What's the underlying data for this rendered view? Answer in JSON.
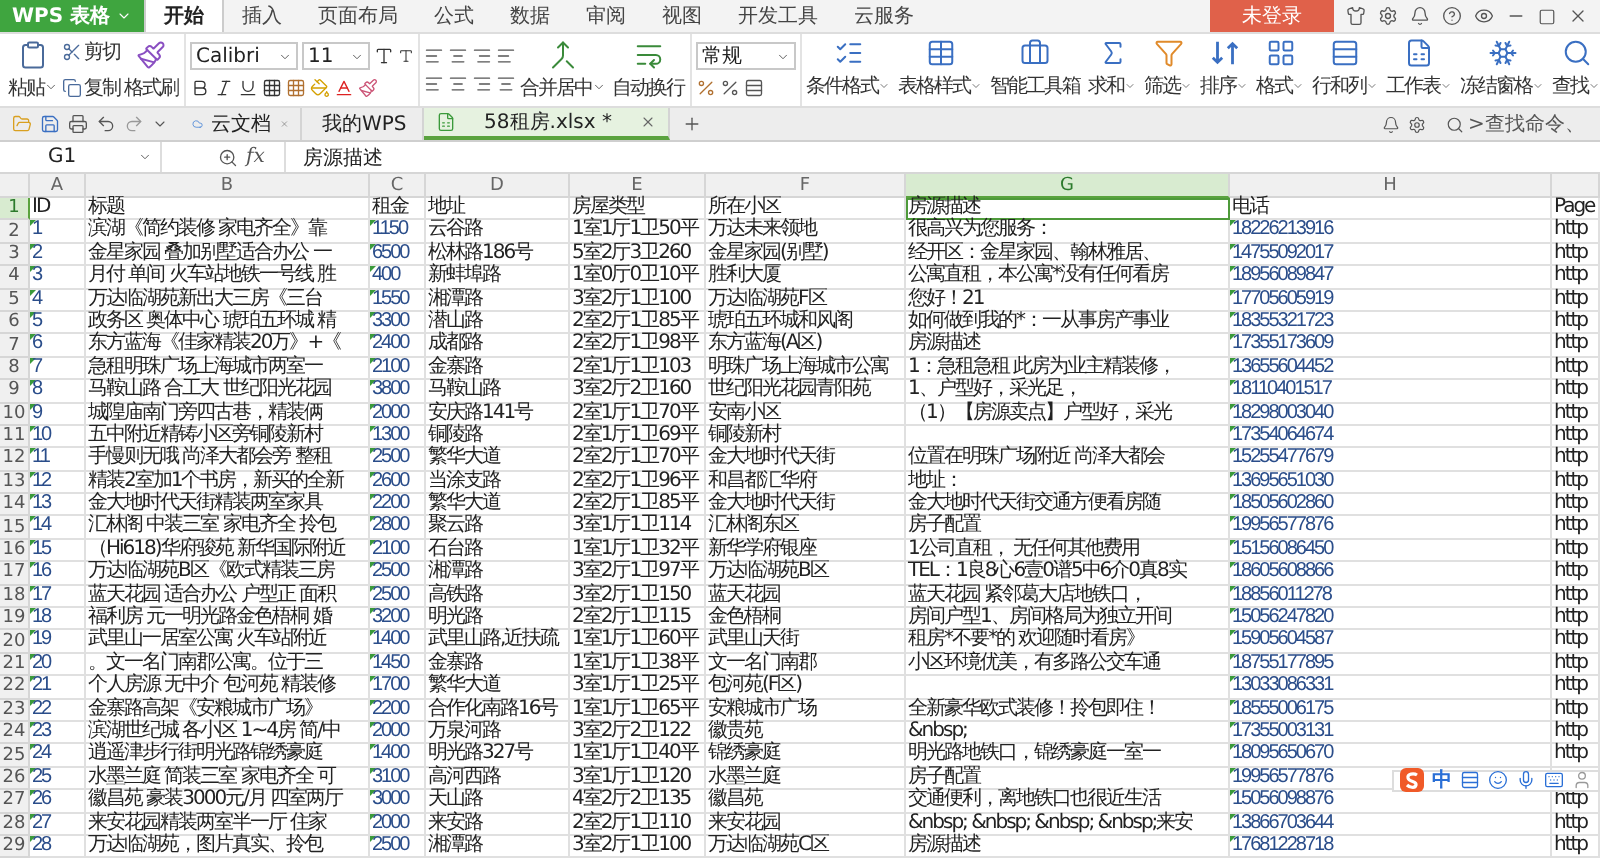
{
  "app": {
    "name": "WPS 表格"
  },
  "menu_tabs": [
    {
      "label": "开始",
      "selected": true
    },
    {
      "label": "插入",
      "selected": false
    },
    {
      "label": "页面布局",
      "selected": false
    },
    {
      "label": "公式",
      "selected": false
    },
    {
      "label": "数据",
      "selected": false
    },
    {
      "label": "审阅",
      "selected": false
    },
    {
      "label": "视图",
      "selected": false
    },
    {
      "label": "开发工具",
      "selected": false
    },
    {
      "label": "云服务",
      "selected": false
    }
  ],
  "login_button": "未登录",
  "ribbon": {
    "paste": "粘贴",
    "cut": "剪切",
    "copy": "复制",
    "format_painter": "格式刷",
    "font_name": "Calibri",
    "font_size": "11",
    "merge": "合并居中",
    "wrap": "自动换行",
    "number_format": "常规",
    "tools": [
      {
        "label": "条件格式",
        "kind": "conditional",
        "dropdown": true
      },
      {
        "label": "表格样式",
        "kind": "table_style",
        "dropdown": true
      },
      {
        "label": "智能工具箱",
        "kind": "toolbox",
        "dropdown": false
      },
      {
        "label": "求和",
        "kind": "sum",
        "dropdown": true
      },
      {
        "label": "筛选",
        "kind": "filter",
        "dropdown": true
      },
      {
        "label": "排序",
        "kind": "sort",
        "dropdown": true
      },
      {
        "label": "格式",
        "kind": "format",
        "dropdown": true
      },
      {
        "label": "行和列",
        "kind": "rows_cols",
        "dropdown": true
      },
      {
        "label": "工作表",
        "kind": "sheet",
        "dropdown": true
      },
      {
        "label": "冻结窗格",
        "kind": "freeze",
        "dropdown": true
      },
      {
        "label": "查找",
        "kind": "find",
        "dropdown": true
      }
    ]
  },
  "doc_tabs": [
    {
      "label": "云文档",
      "kind": "cloud",
      "selected": false
    },
    {
      "label": "我的WPS",
      "kind": "wps",
      "selected": false
    },
    {
      "label": "58租房.xlsx *",
      "kind": "sheet",
      "selected": true
    }
  ],
  "command_search": {
    "placeholder": ">查找命令、"
  },
  "formula_bar": {
    "cell": "G1",
    "fx": "fx",
    "value": "房源描述"
  },
  "columns": [
    {
      "letter": "A",
      "selected": false
    },
    {
      "letter": "B",
      "selected": false
    },
    {
      "letter": "C",
      "selected": false
    },
    {
      "letter": "D",
      "selected": false
    },
    {
      "letter": "E",
      "selected": false
    },
    {
      "letter": "F",
      "selected": false
    },
    {
      "letter": "G",
      "selected": true
    },
    {
      "letter": "H",
      "selected": false
    },
    {
      "selected": false
    }
  ],
  "rows": [
    {
      "number": "1",
      "selected": true,
      "id": "ID",
      "title": "标题",
      "rent": "租金",
      "address": "地址",
      "type": "房屋类型",
      "community": "所在小区",
      "description": "房源描述",
      "phone": "电话",
      "page": "Page"
    },
    {
      "number": "2",
      "selected": false,
      "id": "1",
      "title": "滨湖《简约装修 家电齐全》靠",
      "rent": "1150",
      "address": "云谷路",
      "type": "1室1厅1卫50平",
      "community": "万达未来领地",
      "description": "很高兴为您服务：",
      "phone": "18226213916",
      "page": "http"
    },
    {
      "number": "3",
      "selected": false,
      "id": "2",
      "title": "金星家园 叠加别墅适合办公 一",
      "rent": "6500",
      "address": "松林路186号",
      "type": "5室2厅3卫260",
      "community": "金星家园(别墅)",
      "description": "经开区：金星家园、翰林雅居、",
      "phone": "14755092017",
      "page": "http"
    },
    {
      "number": "4",
      "selected": false,
      "id": "3",
      "title": "月付 单间 火车站地铁一号线 胜",
      "rent": "400",
      "address": "新蚌埠路",
      "type": "1室0厅0卫10平",
      "community": "胜利大厦",
      "description": "公寓直租，本公寓*没有任何看房",
      "phone": "18956089847",
      "page": "http"
    },
    {
      "number": "5",
      "selected": false,
      "id": "4",
      "title": "万达临湖苑新出大三房《三台",
      "rent": "1550",
      "address": "湘潭路",
      "type": "3室2厅1卫100",
      "community": "万达临湖苑F区",
      "description": "您好！21",
      "phone": "17705605919",
      "page": "http"
    },
    {
      "number": "6",
      "selected": false,
      "id": "5",
      "title": "政务区 奥体中心 琥珀五环城 精",
      "rent": "3300",
      "address": "潜山路",
      "type": "2室2厅1卫85平",
      "community": "琥珀五环城和风阁",
      "description": "如何做到我的*：一从事房产事业",
      "phone": "18355321723",
      "page": "http"
    },
    {
      "number": "7",
      "selected": false,
      "id": "6",
      "title": "东方蓝海《佳家精装20万》+《",
      "rent": "2400",
      "address": "成都路",
      "type": "2室2厅1卫98平",
      "community": "东方蓝海(A区)",
      "description": "房源描述",
      "phone": "17355173609",
      "page": "http"
    },
    {
      "number": "8",
      "selected": false,
      "id": "7",
      "title": "急租明珠广场上海城市两室一",
      "rent": "2100",
      "address": "金寨路",
      "type": "2室1厅1卫103",
      "community": "明珠广场上海城市公寓",
      "description": "1：急租急租 此房为业主精装修，",
      "phone": "13655604452",
      "page": "http"
    },
    {
      "number": "9",
      "selected": false,
      "id": "8",
      "title": "马鞍山路 合工大 世纪阳光花园",
      "rent": "3800",
      "address": "马鞍山路",
      "type": "3室2厅2卫160",
      "community": "世纪阳光花园青阳苑",
      "description": "1、户型好，采光足，",
      "phone": "18110401517",
      "page": "http"
    },
    {
      "number": "10",
      "selected": false,
      "id": "9",
      "title": "城隍庙南门旁四古巷，精装俩",
      "rent": "2000",
      "address": "安庆路141号",
      "type": "2室1厅1卫70平",
      "community": "安南小区",
      "description": "（1）【房源卖点】户型好，采光",
      "phone": "18298003040",
      "page": "http"
    },
    {
      "number": "11",
      "selected": false,
      "id": "10",
      "title": "五中附近精铸小区旁铜陵新村",
      "rent": "1300",
      "address": "铜陵路",
      "type": "2室1厅1卫69平",
      "community": "铜陵新村",
      "phone": "17354064674",
      "page": "http"
    },
    {
      "number": "12",
      "selected": false,
      "id": "11",
      "title": "手慢则无哦 尚泽大都会旁 整租",
      "rent": "2500",
      "address": "繁华大道",
      "type": "2室2厅1卫70平",
      "community": "金大地时代天街",
      "description": "位置在明珠广场附近 尚泽大都会",
      "phone": "15255477679",
      "page": "http"
    },
    {
      "number": "13",
      "selected": false,
      "id": "12",
      "title": "精装2室加1个书房，新买的全新",
      "rent": "2600",
      "address": "当涂支路",
      "type": "2室2厅1卫96平",
      "community": "和昌都汇华府",
      "description": "地址：",
      "phone": "13695651030",
      "page": "http"
    },
    {
      "number": "14",
      "selected": false,
      "id": "13",
      "title": "金大地时代天街精装两室家具",
      "rent": "2200",
      "address": "繁华大道",
      "type": "2室2厅1卫85平",
      "community": "金大地时代天街",
      "description": "金大地时代天街交通方便看房随",
      "phone": "18505602860",
      "page": "http"
    },
    {
      "number": "15",
      "selected": false,
      "id": "14",
      "title": "汇林阁 中装三室 家电齐全 拎包",
      "rent": "2800",
      "address": "聚云路",
      "type": "3室1厅1卫114",
      "community": "汇林阁东区",
      "description": "房子配置",
      "phone": "19956577876",
      "page": "http"
    },
    {
      "number": "16",
      "selected": false,
      "id": "15",
      "title": "（Hi618)华府骏苑 新华国际附近",
      "rent": "2100",
      "address": "石台路",
      "type": "1室1厅1卫32平",
      "community": "新华学府银座",
      "description": "1公司直租， 无任何其他费用",
      "phone": "15156086450",
      "page": "http"
    },
    {
      "number": "17",
      "selected": false,
      "id": "16",
      "title": "万达临湖苑B区《欧式精装三房",
      "rent": "2500",
      "address": "湘潭路",
      "type": "3室2厅1卫97平",
      "community": "万达临湖苑B区",
      "description": "TEL：1良8心6壹0谱5中6介0真8实",
      "phone": "18605608866",
      "page": "http"
    },
    {
      "number": "18",
      "selected": false,
      "id": "17",
      "title": "蓝天花园 适合办公 户型正 面积",
      "rent": "2500",
      "address": "高铁路",
      "type": "3室2厅1卫150",
      "community": "蓝天花园",
      "description": "蓝天花园  紧邻葛大店地铁口，",
      "phone": "18856011278",
      "page": "http"
    },
    {
      "number": "19",
      "selected": false,
      "id": "18",
      "title": "福利房 元一明光路金色梧桐 婚",
      "rent": "3200",
      "address": "明光路",
      "type": "2室2厅1卫115",
      "community": "金色梧桐",
      "description": "房间户型1、房间格局为独立开间",
      "phone": "15056247820",
      "page": "http"
    },
    {
      "number": "20",
      "selected": false,
      "id": "19",
      "title": "武里山一居室公寓 火车站附近",
      "rent": "1400",
      "address": "武里山路,近扶疏",
      "type": "1室1厅1卫60平",
      "community": "武里山天街",
      "description": "租房*不要*的 欢迎随时看房》",
      "phone": "15905604587",
      "page": "http"
    },
    {
      "number": "21",
      "selected": false,
      "id": "20",
      "title": "。文一名门南郡公寓。位于三",
      "rent": "1450",
      "address": "金寨路",
      "type": "1室1厅1卫38平",
      "community": "文一名门南郡",
      "description": "小区环境优美，有多路公交车通",
      "phone": "18755177895",
      "page": "http"
    },
    {
      "number": "22",
      "selected": false,
      "id": "21",
      "title": "个人房源 无中介 包河苑 精装修",
      "rent": "1700",
      "address": "繁华大道",
      "type": "3室1厅1卫25平",
      "community": "包河苑(F区)",
      "phone": "13033086331",
      "page": "http"
    },
    {
      "number": "23",
      "selected": false,
      "id": "22",
      "title": "金寨路高架《安粮城市广场》",
      "rent": "2200",
      "address": "合作化南路16号",
      "type": "1室1厅1卫65平",
      "community": "安粮城市广场",
      "description": "全新豪华欧式装修！拎包即住！",
      "phone": "18555006175",
      "page": "http"
    },
    {
      "number": "24",
      "selected": false,
      "id": "23",
      "title": "滨湖世纪城 各小区 1~4房 简/中",
      "rent": "2000",
      "address": "万泉河路",
      "type": "3室2厅2卫122",
      "community": "徽贵苑",
      "description": "&nbsp;",
      "phone": "17355003131",
      "page": "http"
    },
    {
      "number": "25",
      "selected": false,
      "id": "24",
      "title": "逍遥津步行街明光路锦绣豪庭",
      "rent": "1400",
      "address": "明光路327号",
      "type": "1室1厅1卫40平",
      "community": "锦绣豪庭",
      "description": "明光路地铁口，锦绣豪庭一室一",
      "phone": "18095650670",
      "page": "http"
    },
    {
      "number": "26",
      "selected": false,
      "id": "25",
      "title": "水墨兰庭 简装三室 家电齐全 可",
      "rent": "3100",
      "address": "高河西路",
      "type": "3室1厅1卫120",
      "community": "水墨兰庭",
      "description": "房子配置",
      "phone": "19956577876"
    },
    {
      "number": "27",
      "selected": false,
      "id": "26",
      "title": "徽昌苑 豪装3000元/月 四室两厅",
      "rent": "3000",
      "address": "天山路",
      "type": "4室2厅2卫135",
      "community": "徽昌苑",
      "description": "交通便利，离地铁口也很近生活",
      "phone": "15056098876",
      "page": "http"
    },
    {
      "number": "28",
      "selected": false,
      "id": "27",
      "title": "来安花园精装两室半一厅 住家",
      "rent": "2000",
      "address": "来安路",
      "type": "2室2厅1卫110",
      "community": "来安花园",
      "description": "&nbsp; &nbsp; &nbsp; &nbsp;来安",
      "phone": "13866703644",
      "page": "http"
    },
    {
      "number": "29",
      "selected": false,
      "id": "28",
      "title": "万达临湖苑，图片真实、拎包",
      "rent": "2500",
      "address": "湘潭路",
      "type": "3室2厅1卫100",
      "community": "万达临湖苑C区",
      "description": "房源描述",
      "phone": "17681228718",
      "page": "http"
    }
  ],
  "ime_bar": {
    "mode": "中"
  }
}
